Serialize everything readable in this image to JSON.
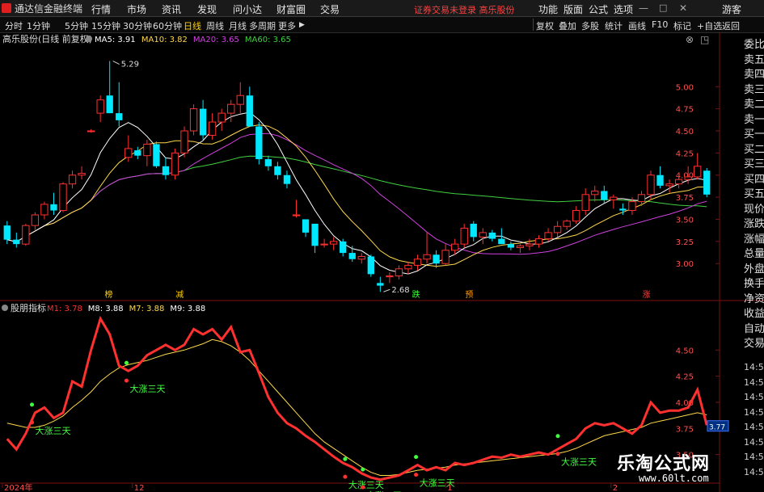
{
  "menubar": {
    "app_name": "通达信金融终端",
    "menus": [
      "行情",
      "市场",
      "资讯",
      "发现",
      "问小达",
      "财富圈",
      "交易"
    ],
    "warning": "证券交易未登录 高乐股份",
    "right_menus": [
      "功能",
      "版面",
      "公式",
      "选项"
    ],
    "guest": "游客"
  },
  "toolbar": {
    "periods": [
      "分时",
      "1分钟",
      "5分钟",
      "15分钟",
      "30分钟",
      "60分钟",
      "日线",
      "周线",
      "月线",
      "多周期",
      "更多"
    ],
    "active_period": "日线",
    "right_buttons": [
      "复权",
      "叠加",
      "多股",
      "统计",
      "画线",
      "F10",
      "标记",
      "+自选",
      "返回"
    ]
  },
  "main_panel": {
    "title": "高乐股份(日线 前复权)",
    "ma_labels": [
      {
        "text": "MA5: 3.91",
        "color": "#ffffff"
      },
      {
        "text": "MA10: 3.82",
        "color": "#ffd84a"
      },
      {
        "text": "MA20: 3.65",
        "color": "#d040e0"
      },
      {
        "text": "MA60: 3.65",
        "color": "#40d040"
      }
    ],
    "price_axis": [
      "5.00",
      "4.75",
      "4.50",
      "4.25",
      "4.00",
      "3.75",
      "3.50",
      "3.25",
      "3.00"
    ],
    "high_label": "5.29",
    "low_label": "2.68",
    "markers": [
      "榜",
      "减",
      "跌",
      "预",
      "涨"
    ]
  },
  "indicator_panel": {
    "title": "股朋指标",
    "labels": [
      {
        "text": "M1: 3.78",
        "color": "#ff3030"
      },
      {
        "text": "M8: 3.88",
        "color": "#ffffff"
      },
      {
        "text": "M7: 3.88",
        "color": "#ffd84a"
      },
      {
        "text": "M9: 3.88",
        "color": "#ffffff"
      }
    ],
    "axis": [
      "4.50",
      "4.25",
      "4.00",
      "3.75",
      "3.50"
    ],
    "current_value": "3.77",
    "signal_text": "大涨三天"
  },
  "date_axis": [
    "2024年",
    "12",
    "1",
    "2"
  ],
  "right_panel": {
    "items": [
      "委比",
      "卖五",
      "卖四",
      "卖三",
      "卖二",
      "卖一",
      "买一",
      "买二",
      "买三",
      "买四",
      "买五",
      "现价",
      "涨跌",
      "涨幅",
      "总量",
      "外盘",
      "换手",
      "净资",
      "收益",
      "自动",
      "交易",
      "14:56",
      "14:56",
      "14:56",
      "14:56",
      "14:56",
      "14:56",
      "14:56",
      "14:56"
    ]
  },
  "watermark": {
    "line1": "乐淘公式网",
    "line2": "www.60lt.com"
  },
  "colors": {
    "up": "#ff3030",
    "down": "#00e8ff",
    "ma5": "#ffffff",
    "ma10": "#ffd84a",
    "ma20": "#d040e0",
    "ma60": "#40d040",
    "grid": "#7a1010",
    "signal": "#40ff40"
  },
  "chart_data": {
    "type": "candlestick",
    "price_range": [
      2.6,
      5.45
    ],
    "candles": [
      [
        3.43,
        3.48,
        3.22,
        3.27
      ],
      [
        3.27,
        3.35,
        3.18,
        3.22
      ],
      [
        3.22,
        3.45,
        3.2,
        3.43
      ],
      [
        3.43,
        3.58,
        3.38,
        3.55
      ],
      [
        3.55,
        3.7,
        3.5,
        3.67
      ],
      [
        3.67,
        3.8,
        3.55,
        3.6
      ],
      [
        3.6,
        3.92,
        3.58,
        3.9
      ],
      [
        3.9,
        4.05,
        3.85,
        4.0
      ],
      [
        4.0,
        4.1,
        3.95,
        4.02
      ],
      [
        4.5,
        4.52,
        4.48,
        4.5
      ],
      [
        4.7,
        4.9,
        4.6,
        4.85
      ],
      [
        4.9,
        5.29,
        4.7,
        4.7
      ],
      [
        4.7,
        5.05,
        4.55,
        4.62
      ],
      [
        4.2,
        4.45,
        4.15,
        4.3
      ],
      [
        4.28,
        4.32,
        4.18,
        4.22
      ],
      [
        4.22,
        4.4,
        4.1,
        4.35
      ],
      [
        4.35,
        4.38,
        4.08,
        4.1
      ],
      [
        4.1,
        4.2,
        3.95,
        4.0
      ],
      [
        4.0,
        4.3,
        3.95,
        4.25
      ],
      [
        4.25,
        4.55,
        4.2,
        4.5
      ],
      [
        4.5,
        4.8,
        4.45,
        4.75
      ],
      [
        4.75,
        4.85,
        4.4,
        4.45
      ],
      [
        4.45,
        4.7,
        4.4,
        4.6
      ],
      [
        4.6,
        4.75,
        4.5,
        4.7
      ],
      [
        4.7,
        4.85,
        4.6,
        4.8
      ],
      [
        4.8,
        5.05,
        4.7,
        4.9
      ],
      [
        4.9,
        5.0,
        4.55,
        4.55
      ],
      [
        4.55,
        4.6,
        4.12,
        4.18
      ],
      [
        4.18,
        4.22,
        4.05,
        4.1
      ],
      [
        4.1,
        4.15,
        3.95,
        4.0
      ],
      [
        4.0,
        4.05,
        3.85,
        3.9
      ],
      [
        3.55,
        3.72,
        3.52,
        3.55
      ],
      [
        3.5,
        3.5,
        3.3,
        3.35
      ],
      [
        3.45,
        3.45,
        3.12,
        3.2
      ],
      [
        3.22,
        3.28,
        3.18,
        3.22
      ],
      [
        3.22,
        3.3,
        3.15,
        3.25
      ],
      [
        3.25,
        3.28,
        3.08,
        3.12
      ],
      [
        3.12,
        3.2,
        3.02,
        3.05
      ],
      [
        3.05,
        3.12,
        3.0,
        3.08
      ],
      [
        3.08,
        3.1,
        2.85,
        2.88
      ],
      [
        2.78,
        2.85,
        2.68,
        2.75
      ],
      [
        2.85,
        2.9,
        2.78,
        2.86
      ],
      [
        2.86,
        2.98,
        2.82,
        2.94
      ],
      [
        2.94,
        3.02,
        2.88,
        2.98
      ],
      [
        2.98,
        3.1,
        2.92,
        3.05
      ],
      [
        3.05,
        3.35,
        3.0,
        3.1
      ],
      [
        3.1,
        3.15,
        2.95,
        3.0
      ],
      [
        3.0,
        3.22,
        2.98,
        3.15
      ],
      [
        3.15,
        3.28,
        3.1,
        3.22
      ],
      [
        3.22,
        3.45,
        3.18,
        3.4
      ],
      [
        3.45,
        3.48,
        3.25,
        3.3
      ],
      [
        3.3,
        3.4,
        3.22,
        3.35
      ],
      [
        3.35,
        3.38,
        3.25,
        3.28
      ],
      [
        3.28,
        3.4,
        3.25,
        3.22
      ],
      [
        3.22,
        3.25,
        3.15,
        3.18
      ],
      [
        3.18,
        3.22,
        3.12,
        3.2
      ],
      [
        3.2,
        3.28,
        3.15,
        3.22
      ],
      [
        3.22,
        3.32,
        3.18,
        3.28
      ],
      [
        3.28,
        3.4,
        3.25,
        3.35
      ],
      [
        3.35,
        3.48,
        3.3,
        3.42
      ],
      [
        3.42,
        3.5,
        3.38,
        3.48
      ],
      [
        3.48,
        3.65,
        3.45,
        3.6
      ],
      [
        3.6,
        3.85,
        3.55,
        3.78
      ],
      [
        3.78,
        3.88,
        3.7,
        3.82
      ],
      [
        3.82,
        3.88,
        3.68,
        3.72
      ],
      [
        3.72,
        3.78,
        3.62,
        3.75
      ],
      [
        3.62,
        3.68,
        3.55,
        3.6
      ],
      [
        3.6,
        3.75,
        3.55,
        3.7
      ],
      [
        3.7,
        3.82,
        3.65,
        3.78
      ],
      [
        3.78,
        4.05,
        3.72,
        4.0
      ],
      [
        4.0,
        4.1,
        3.85,
        3.88
      ],
      [
        3.88,
        3.95,
        3.8,
        3.9
      ],
      [
        3.9,
        4.0,
        3.85,
        3.95
      ],
      [
        3.95,
        4.1,
        3.9,
        3.98
      ],
      [
        3.98,
        4.25,
        3.95,
        4.1
      ],
      [
        4.05,
        4.08,
        3.75,
        3.78
      ]
    ],
    "indicator_range": [
      3.25,
      4.85
    ],
    "m1": [
      3.65,
      3.55,
      3.7,
      3.9,
      3.95,
      3.85,
      3.9,
      4.2,
      4.15,
      4.5,
      4.8,
      4.65,
      4.35,
      4.3,
      4.35,
      4.45,
      4.5,
      4.55,
      4.5,
      4.55,
      4.7,
      4.65,
      4.7,
      4.6,
      4.72,
      4.48,
      4.5,
      4.28,
      4.05,
      3.9,
      3.8,
      3.75,
      3.68,
      3.62,
      3.55,
      3.48,
      3.42,
      3.38,
      3.32,
      3.28,
      3.26,
      3.28,
      3.3,
      3.35,
      3.4,
      3.35,
      3.38,
      3.35,
      3.42,
      3.4,
      3.42,
      3.45,
      3.48,
      3.47,
      3.5,
      3.48,
      3.5,
      3.52,
      3.5,
      3.55,
      3.6,
      3.65,
      3.75,
      3.8,
      3.78,
      3.8,
      3.75,
      3.7,
      3.78,
      4.0,
      3.9,
      3.92,
      3.92,
      3.95,
      4.12,
      3.78
    ],
    "m7": [
      3.8,
      3.78,
      3.76,
      3.76,
      3.78,
      3.82,
      3.87,
      3.95,
      4.02,
      4.1,
      4.2,
      4.27,
      4.33,
      4.36,
      4.38,
      4.4,
      4.43,
      4.46,
      4.48,
      4.5,
      4.53,
      4.56,
      4.6,
      4.58,
      4.54,
      4.48,
      4.4,
      4.3,
      4.2,
      4.1,
      4.0,
      3.9,
      3.8,
      3.7,
      3.62,
      3.56,
      3.5,
      3.44,
      3.38,
      3.33,
      3.3,
      3.3,
      3.31,
      3.33,
      3.35,
      3.36,
      3.37,
      3.38,
      3.4,
      3.41,
      3.42,
      3.43,
      3.44,
      3.45,
      3.46,
      3.47,
      3.48,
      3.49,
      3.5,
      3.51,
      3.53,
      3.56,
      3.6,
      3.64,
      3.68,
      3.7,
      3.72,
      3.74,
      3.76,
      3.8,
      3.82,
      3.84,
      3.86,
      3.88,
      3.9,
      3.88
    ],
    "signals": [
      5,
      21,
      58,
      61,
      70,
      94
    ],
    "marker_positions": [
      18,
      30,
      70,
      79,
      109
    ],
    "high_index": 11,
    "low_index": 40
  }
}
